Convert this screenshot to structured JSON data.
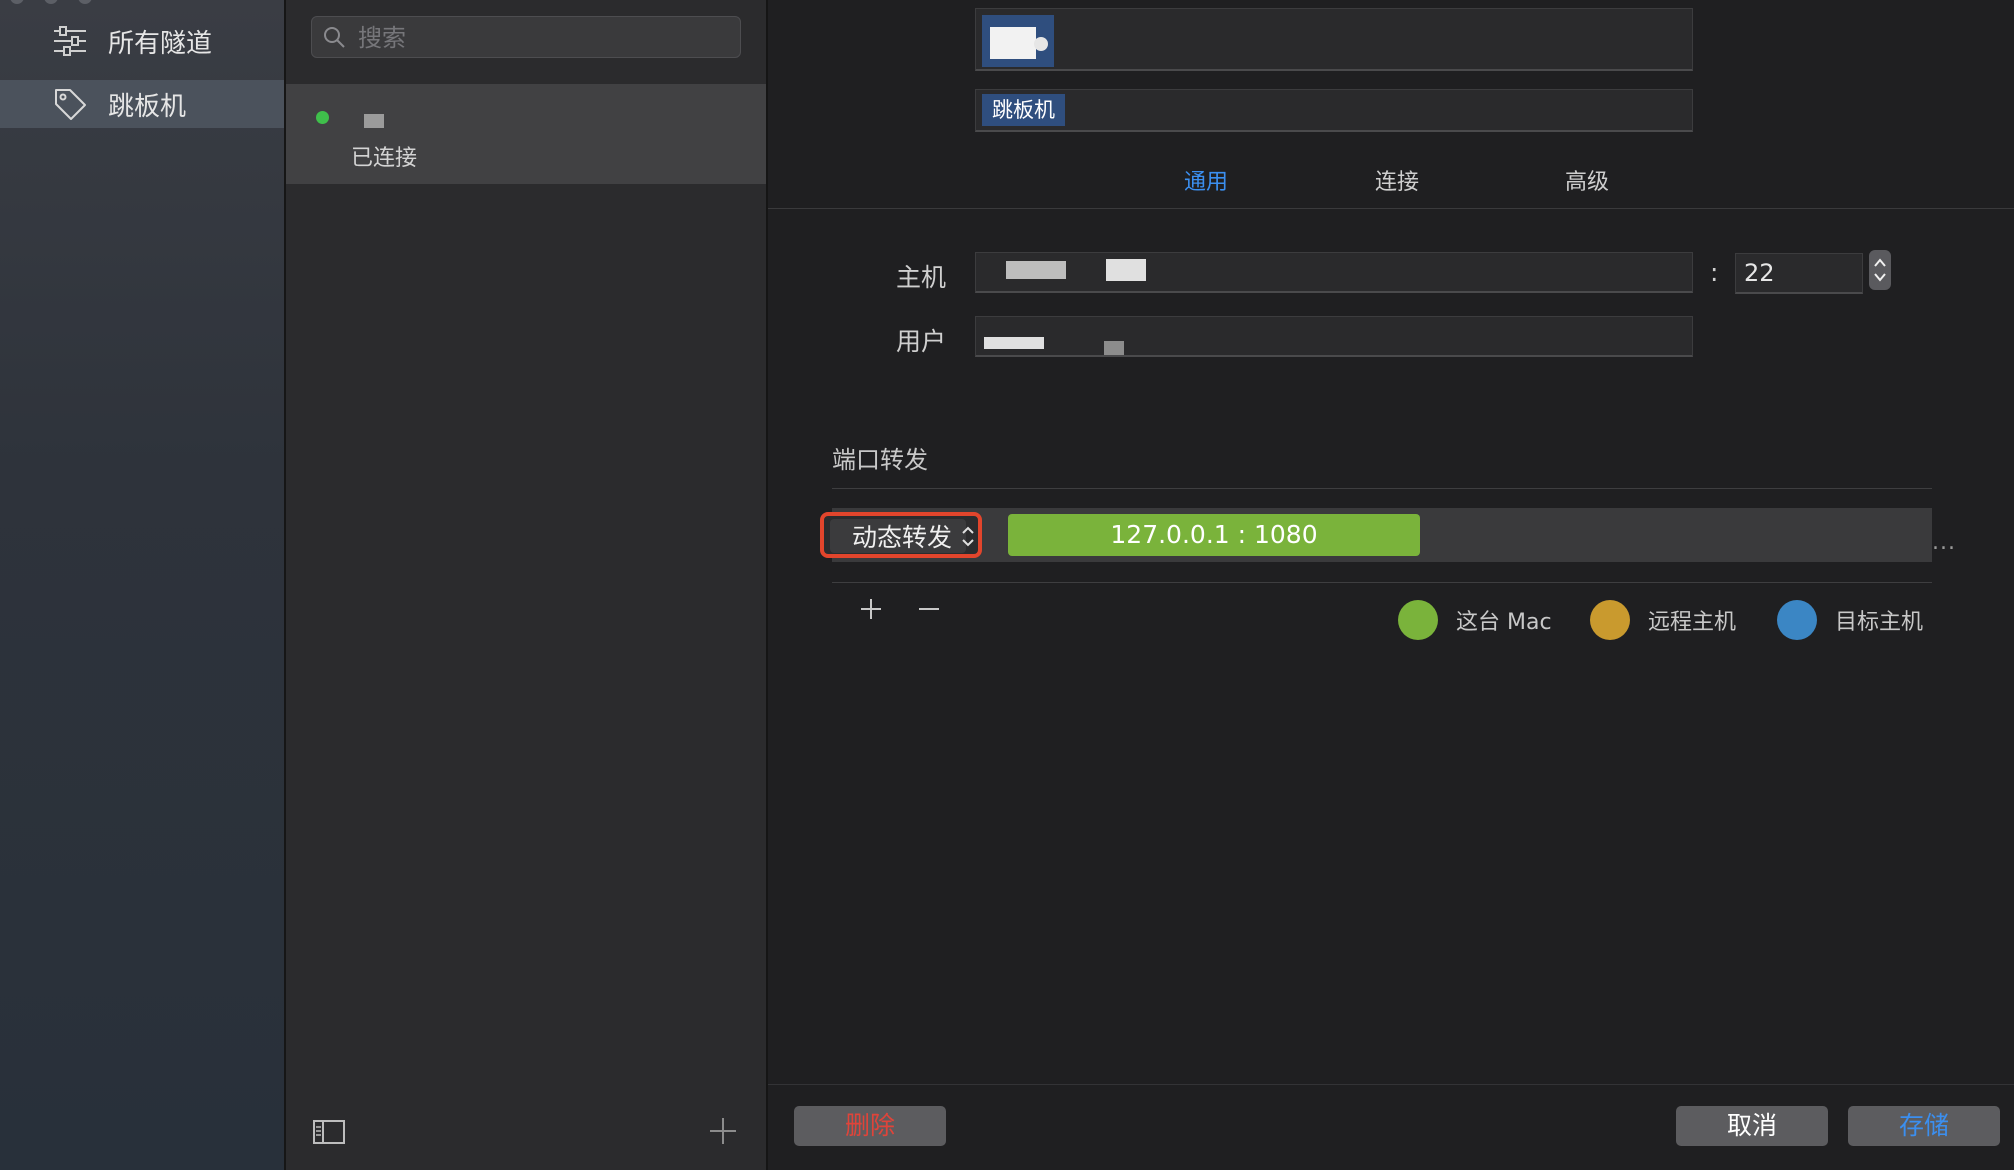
{
  "sidebar": {
    "items": [
      {
        "label": "所有隧道",
        "icon": "sliders-icon"
      },
      {
        "label": "跳板机",
        "icon": "tag-icon"
      }
    ]
  },
  "list": {
    "search_placeholder": "搜索",
    "tunnels": [
      {
        "status": "已连接",
        "status_color": "#3fbf4b"
      }
    ]
  },
  "detail": {
    "group_tag": "跳板机",
    "tabs": [
      "通用",
      "连接",
      "高级"
    ],
    "active_tab": "通用",
    "host_label": "主机",
    "port_separator": ":",
    "port": "22",
    "user_label": "用户",
    "section_title": "端口转发",
    "forward_rule": {
      "type": "动态转发",
      "endpoint": "127.0.0.1 : 1080",
      "more": "..."
    },
    "legend": [
      {
        "label": "这台 Mac",
        "color": "#7ab33b"
      },
      {
        "label": "远程主机",
        "color": "#c99a2e"
      },
      {
        "label": "目标主机",
        "color": "#3b86c4"
      }
    ],
    "buttons": {
      "delete": "删除",
      "cancel": "取消",
      "save": "存储"
    }
  },
  "colors": {
    "accent": "#3b8ff0",
    "danger": "#e0443a",
    "highlight_border": "#e2452c"
  }
}
